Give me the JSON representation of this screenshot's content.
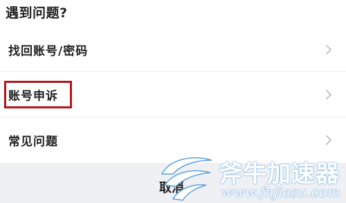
{
  "sheet": {
    "title": "遇到问题?",
    "items": [
      {
        "label": "找回账号/密码",
        "icon": "chevron-right-icon"
      },
      {
        "label": "账号申诉",
        "icon": "chevron-right-icon",
        "highlighted": true
      },
      {
        "label": "常见问题",
        "icon": "chevron-right-icon"
      }
    ],
    "cancel_label": "取消"
  },
  "watermark": {
    "title": "斧牛加速器",
    "url": "www.fnjiasu.com",
    "color": "#4a90d9"
  },
  "colors": {
    "highlight": "#b5141a",
    "cancel_background": "#eef0f3",
    "divider": "#ececec"
  }
}
